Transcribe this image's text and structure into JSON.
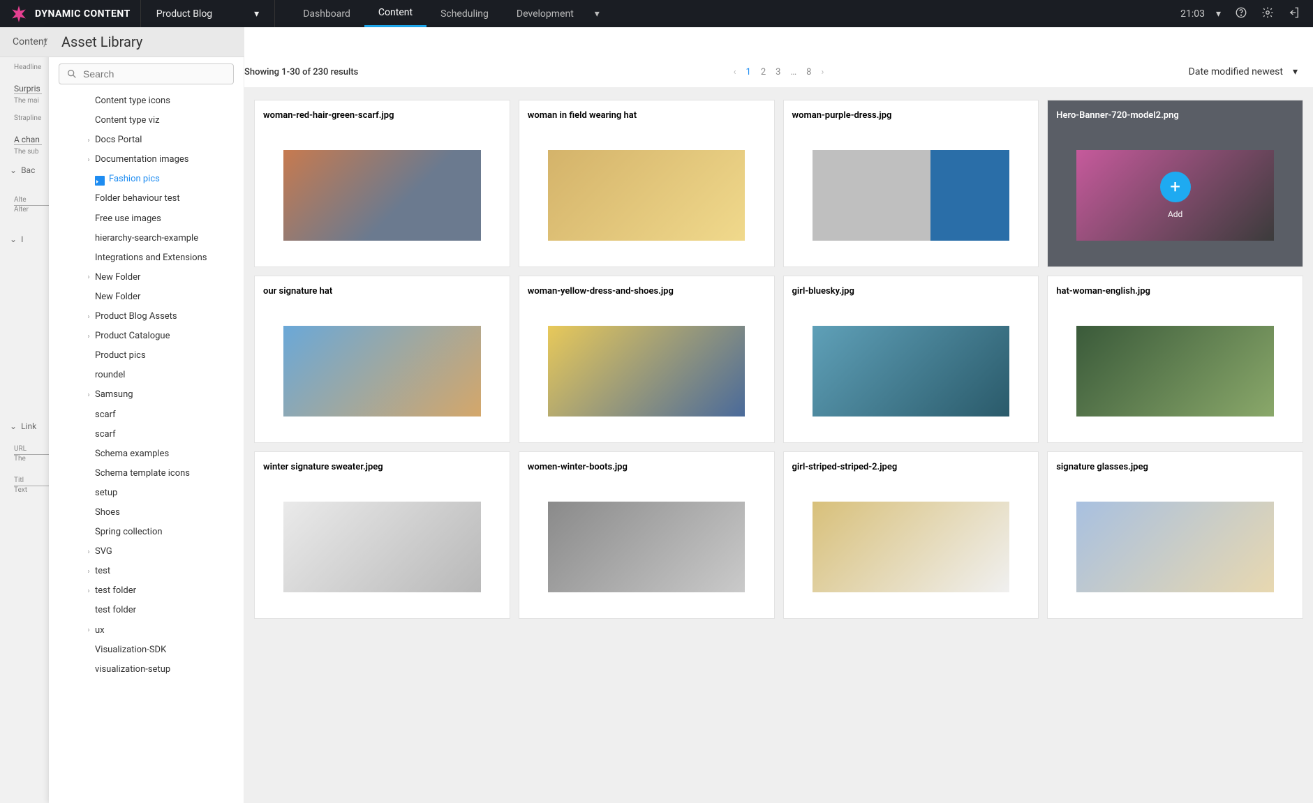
{
  "brand": "DYNAMIC CONTENT",
  "hub": "Product Blog",
  "nav": {
    "dashboard": "Dashboard",
    "content": "Content",
    "scheduling": "Scheduling",
    "development": "Development"
  },
  "time": "21:03",
  "breadcrumb": "Content",
  "library_title": "Asset Library",
  "add_button": "Add",
  "search": {
    "placeholder": "Search"
  },
  "backdrop": {
    "headline_label": "Headline",
    "headline_val": "Surpris",
    "headline_help": "The mai",
    "strap_label": "Strapline",
    "strap_val": "A chan",
    "strap_help": "The sub",
    "bac": "Bac",
    "alt_label": "Alte",
    "alt_help": "Alter",
    "i_row": "I",
    "link": "Link",
    "url_label": "URL",
    "url_help": "The",
    "title_label": "Titl",
    "title_help": "Text"
  },
  "tree": [
    {
      "label": "Content type icons",
      "expandable": false,
      "indent": 2
    },
    {
      "label": "Content type viz",
      "expandable": false,
      "indent": 2
    },
    {
      "label": "Docs Portal",
      "expandable": true,
      "indent": 2
    },
    {
      "label": "Documentation images",
      "expandable": true,
      "indent": 2
    },
    {
      "label": "Fashion pics",
      "expandable": false,
      "indent": 2,
      "selected": true
    },
    {
      "label": "Folder behaviour test",
      "expandable": false,
      "indent": 2
    },
    {
      "label": "Free use images",
      "expandable": false,
      "indent": 2
    },
    {
      "label": "hierarchy-search-example",
      "expandable": false,
      "indent": 2
    },
    {
      "label": "Integrations and Extensions",
      "expandable": false,
      "indent": 2
    },
    {
      "label": "New Folder",
      "expandable": true,
      "indent": 2
    },
    {
      "label": "New Folder",
      "expandable": false,
      "indent": 2
    },
    {
      "label": "Product Blog Assets",
      "expandable": true,
      "indent": 2
    },
    {
      "label": "Product Catalogue",
      "expandable": true,
      "indent": 2
    },
    {
      "label": "Product pics",
      "expandable": false,
      "indent": 2
    },
    {
      "label": "roundel",
      "expandable": false,
      "indent": 2
    },
    {
      "label": "Samsung",
      "expandable": true,
      "indent": 2
    },
    {
      "label": "scarf",
      "expandable": false,
      "indent": 2
    },
    {
      "label": "scarf",
      "expandable": false,
      "indent": 2
    },
    {
      "label": "Schema examples",
      "expandable": false,
      "indent": 2
    },
    {
      "label": "Schema template icons",
      "expandable": false,
      "indent": 2
    },
    {
      "label": "setup",
      "expandable": false,
      "indent": 2
    },
    {
      "label": "Shoes",
      "expandable": false,
      "indent": 2
    },
    {
      "label": "Spring collection",
      "expandable": false,
      "indent": 2
    },
    {
      "label": "SVG",
      "expandable": true,
      "indent": 2
    },
    {
      "label": "test",
      "expandable": true,
      "indent": 2
    },
    {
      "label": "test folder",
      "expandable": true,
      "indent": 2
    },
    {
      "label": "test folder",
      "expandable": false,
      "indent": 2
    },
    {
      "label": "ux",
      "expandable": true,
      "indent": 2
    },
    {
      "label": "Visualization-SDK",
      "expandable": false,
      "indent": 2
    },
    {
      "label": "visualization-setup",
      "expandable": false,
      "indent": 2
    }
  ],
  "results_text": "Showing 1-30 of 230 results",
  "pages": [
    "1",
    "2",
    "3",
    "…",
    "8"
  ],
  "sort_label": "Date modified newest",
  "overlay_add": "Add",
  "assets": [
    {
      "name": "woman-red-hair-green-scarf.jpg",
      "cls": "ph1"
    },
    {
      "name": "woman in field wearing hat",
      "cls": "ph2"
    },
    {
      "name": "woman-purple-dress.jpg",
      "cls": "ph3"
    },
    {
      "name": "Hero-Banner-720-model2.png",
      "cls": "ph4",
      "selected": true
    },
    {
      "name": "our signature hat",
      "cls": "ph5"
    },
    {
      "name": "woman-yellow-dress-and-shoes.jpg",
      "cls": "ph6"
    },
    {
      "name": "girl-bluesky.jpg",
      "cls": "ph7"
    },
    {
      "name": "hat-woman-english.jpg",
      "cls": "ph8"
    },
    {
      "name": "winter signature sweater.jpeg",
      "cls": "ph9"
    },
    {
      "name": "women-winter-boots.jpg",
      "cls": "ph10"
    },
    {
      "name": "girl-striped-striped-2.jpeg",
      "cls": "ph11"
    },
    {
      "name": "signature glasses.jpeg",
      "cls": "ph12"
    }
  ]
}
